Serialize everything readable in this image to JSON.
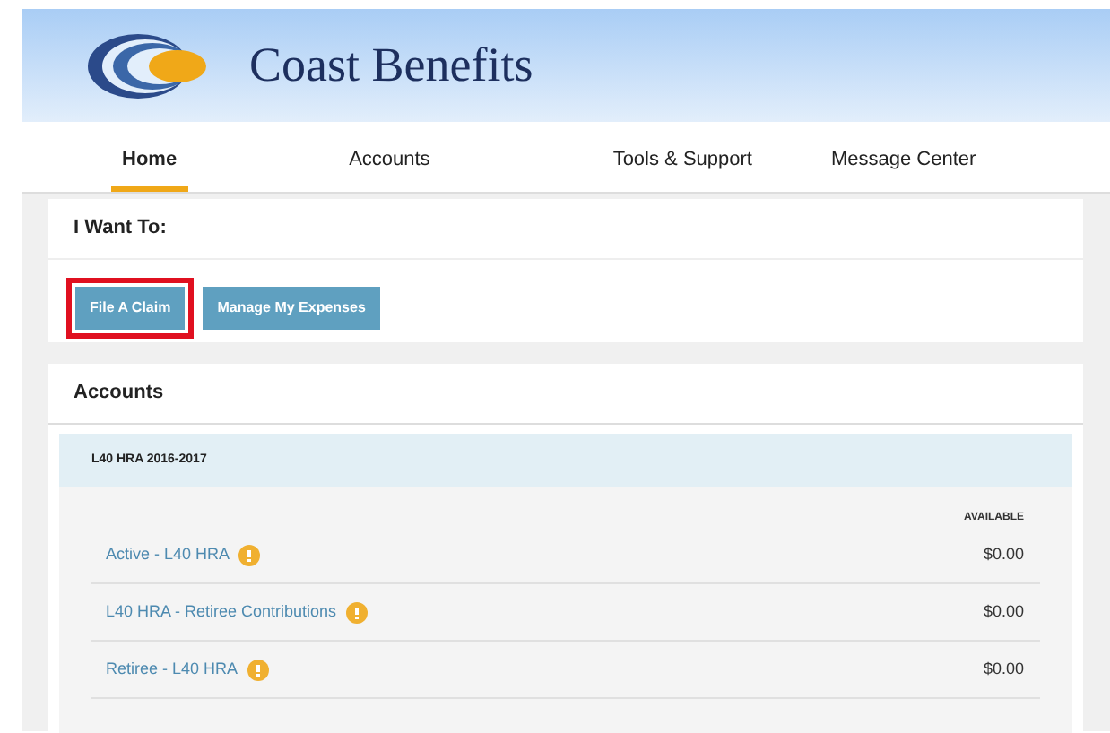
{
  "brand": {
    "name": "Coast Benefits"
  },
  "tabs": [
    {
      "label": "Home",
      "selected": true
    },
    {
      "label": "Accounts",
      "selected": false
    },
    {
      "label": "Tools & Support",
      "selected": false
    },
    {
      "label": "Message Center",
      "selected": false
    }
  ],
  "i_want_to": {
    "title": "I Want To:",
    "buttons": [
      {
        "label": "File A Claim",
        "highlighted": true
      },
      {
        "label": "Manage My Expenses",
        "highlighted": false
      }
    ]
  },
  "accounts": {
    "title": "Accounts",
    "plan": "L40 HRA 2016-2017",
    "column": "AVAILABLE",
    "rows": [
      {
        "name": "Active - L40 HRA",
        "amount": "$0.00"
      },
      {
        "name": "L40 HRA - Retiree Contributions",
        "amount": "$0.00"
      },
      {
        "name": "Retiree - L40 HRA",
        "amount": "$0.00"
      }
    ]
  }
}
